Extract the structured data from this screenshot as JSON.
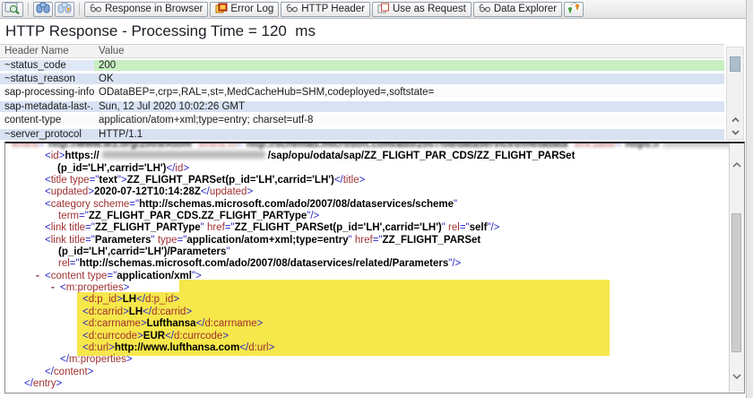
{
  "toolbar": {
    "buttons": [
      {
        "label": "Response in Browser",
        "icon": "glasses-icon"
      },
      {
        "label": "Error Log",
        "icon": "error-log-icon"
      },
      {
        "label": "HTTP Header",
        "icon": "glasses-icon"
      },
      {
        "label": "Use as Request",
        "icon": "copy-icon"
      },
      {
        "label": "Data Explorer",
        "icon": "glasses-icon"
      }
    ],
    "icon_buttons": [
      "display-response-icon",
      "find-icon",
      "find-next-icon",
      "switch-icon"
    ]
  },
  "title": "HTTP Response - Processing Time = 120  ms",
  "header_table": {
    "columns": [
      "Header Name",
      "Value"
    ],
    "rows": [
      {
        "name": "~status_code",
        "value": "200"
      },
      {
        "name": "~status_reason",
        "value": "OK"
      },
      {
        "name": "sap-processing-info",
        "value": "ODataBEP=,crp=,RAL=,st=,MedCacheHub=SHM,codeployed=,softstate="
      },
      {
        "name": "sap-metadata-last-...",
        "value": "Sun, 12 Jul 2020 10:02:26 GMT"
      },
      {
        "name": "content-type",
        "value": "application/atom+xml;type=entry; charset=utf-8"
      },
      {
        "name": "~server_protocol",
        "value": "HTTP/1.1"
      }
    ]
  },
  "colors": {
    "status_ok_value_bg": "#c8eec2",
    "header_row_alt_bg": "#d8e2f2",
    "xml_highlight": "#f6e74b",
    "xml_tag_name": "#a03030",
    "xml_punctuation": "#2929c8"
  },
  "xml_body": {
    "lines": [
      {
        "ind": 0,
        "cls": "blurred",
        "seg": [
          [
            "n",
            "xmlns"
          ],
          [
            "p",
            "=\""
          ],
          [
            "v",
            "http://www.w3.org/2005/Atom"
          ],
          [
            "p",
            "\" "
          ],
          [
            "n",
            "xmlns:m"
          ],
          [
            "p",
            "=\""
          ],
          [
            "v",
            "http://schemas.microsoft.com/ado/2007/08/dataservices/metadata"
          ],
          [
            "p",
            "\" "
          ],
          [
            "n",
            "xml:base"
          ],
          [
            "p",
            "=\""
          ],
          [
            "v",
            "https://"
          ],
          [
            "censor",
            ""
          ],
          [
            "v",
            "/sap/opu/odata/sap/"
          ],
          [
            "p",
            "\">"
          ]
        ]
      },
      {
        "ind": 37,
        "seg": [
          [
            "p",
            "<"
          ],
          [
            "n",
            "id"
          ],
          [
            "p",
            ">"
          ],
          [
            "v",
            "https://"
          ],
          [
            "censor",
            ""
          ],
          [
            "v",
            "/sap/opu/odata/sap/ZZ_FLIGHT_PAR_CDS/ZZ_FLIGHT_PARSet"
          ]
        ]
      },
      {
        "ind": 51,
        "seg": [
          [
            "v",
            "(p_id='LH',carrid='LH')"
          ],
          [
            "p",
            "</"
          ],
          [
            "n",
            "id"
          ],
          [
            "p",
            ">"
          ]
        ]
      },
      {
        "ind": 37,
        "seg": [
          [
            "p",
            "<"
          ],
          [
            "n",
            "title"
          ],
          [
            "n",
            " type"
          ],
          [
            "p",
            "=\""
          ],
          [
            "v",
            "text"
          ],
          [
            "p",
            "\">"
          ],
          [
            "v",
            "ZZ_FLIGHT_PARSet(p_id='LH',carrid='LH')"
          ],
          [
            "p",
            "</"
          ],
          [
            "n",
            "title"
          ],
          [
            "p",
            ">"
          ]
        ]
      },
      {
        "ind": 37,
        "seg": [
          [
            "p",
            "<"
          ],
          [
            "n",
            "updated"
          ],
          [
            "p",
            ">"
          ],
          [
            "v",
            "2020-07-12T10:14:28Z"
          ],
          [
            "p",
            "</"
          ],
          [
            "n",
            "updated"
          ],
          [
            "p",
            ">"
          ]
        ]
      },
      {
        "ind": 37,
        "seg": [
          [
            "p",
            "<"
          ],
          [
            "n",
            "category"
          ],
          [
            "n",
            " scheme"
          ],
          [
            "p",
            "=\""
          ],
          [
            "v",
            "http://schemas.microsoft.com/ado/2007/08/dataservices/scheme"
          ],
          [
            "p",
            "\""
          ]
        ]
      },
      {
        "ind": 52,
        "seg": [
          [
            "n",
            "term"
          ],
          [
            "p",
            "=\""
          ],
          [
            "v",
            "ZZ_FLIGHT_PAR_CDS.ZZ_FLIGHT_PARType"
          ],
          [
            "p",
            "\"/>"
          ]
        ]
      },
      {
        "ind": 37,
        "seg": [
          [
            "p",
            "<"
          ],
          [
            "n",
            "link"
          ],
          [
            "n",
            " title"
          ],
          [
            "p",
            "=\""
          ],
          [
            "v",
            "ZZ_FLIGHT_PARType"
          ],
          [
            "p",
            "\" "
          ],
          [
            "n",
            "href"
          ],
          [
            "p",
            "=\""
          ],
          [
            "v",
            "ZZ_FLIGHT_PARSet(p_id='LH',carrid='LH')"
          ],
          [
            "p",
            "\" "
          ],
          [
            "n",
            "rel"
          ],
          [
            "p",
            "=\""
          ],
          [
            "v",
            "self"
          ],
          [
            "p",
            "\"/>"
          ]
        ]
      },
      {
        "ind": 37,
        "seg": [
          [
            "p",
            "<"
          ],
          [
            "n",
            "link"
          ],
          [
            "n",
            " title"
          ],
          [
            "p",
            "=\""
          ],
          [
            "v",
            "Parameters"
          ],
          [
            "p",
            "\" "
          ],
          [
            "n",
            "type"
          ],
          [
            "p",
            "=\""
          ],
          [
            "v",
            "application/atom+xml;type=entry"
          ],
          [
            "p",
            "\" "
          ],
          [
            "n",
            "href"
          ],
          [
            "p",
            "=\""
          ],
          [
            "v",
            "ZZ_FLIGHT_PARSet"
          ]
        ]
      },
      {
        "ind": 52,
        "seg": [
          [
            "v",
            "(p_id='LH',carrid='LH')/Parameters"
          ],
          [
            "p",
            "\""
          ]
        ]
      },
      {
        "ind": 52,
        "seg": [
          [
            "n",
            "rel"
          ],
          [
            "p",
            "=\""
          ],
          [
            "v",
            "http://schemas.microsoft.com/ado/2007/08/dataservices/related/Parameters"
          ],
          [
            "p",
            "\"/>"
          ]
        ]
      },
      {
        "ind": 37,
        "dash": true,
        "seg": [
          [
            "p",
            "<"
          ],
          [
            "n",
            "content"
          ],
          [
            "n",
            " type"
          ],
          [
            "p",
            "=\""
          ],
          [
            "v",
            "application/xml"
          ],
          [
            "p",
            "\">"
          ]
        ]
      },
      {
        "ind": 54,
        "dash": true,
        "seg": [
          [
            "p",
            "<"
          ],
          [
            "n",
            "m:properties"
          ],
          [
            "p",
            ">"
          ]
        ]
      },
      {
        "ind": 79,
        "seg": [
          [
            "p",
            "<"
          ],
          [
            "n",
            "d:p_id"
          ],
          [
            "p",
            ">"
          ],
          [
            "v",
            "LH"
          ],
          [
            "p",
            "</"
          ],
          [
            "n",
            "d:p_id"
          ],
          [
            "p",
            ">"
          ]
        ]
      },
      {
        "ind": 79,
        "seg": [
          [
            "p",
            "<"
          ],
          [
            "n",
            "d:carrid"
          ],
          [
            "p",
            ">"
          ],
          [
            "v",
            "LH"
          ],
          [
            "p",
            "</"
          ],
          [
            "n",
            "d:carrid"
          ],
          [
            "p",
            ">"
          ]
        ]
      },
      {
        "ind": 79,
        "seg": [
          [
            "p",
            "<"
          ],
          [
            "n",
            "d:carrname"
          ],
          [
            "p",
            ">"
          ],
          [
            "v",
            "Lufthansa"
          ],
          [
            "p",
            "</"
          ],
          [
            "n",
            "d:carrname"
          ],
          [
            "p",
            ">"
          ]
        ]
      },
      {
        "ind": 79,
        "seg": [
          [
            "p",
            "<"
          ],
          [
            "n",
            "d:currcode"
          ],
          [
            "p",
            ">"
          ],
          [
            "v",
            "EUR"
          ],
          [
            "p",
            "</"
          ],
          [
            "n",
            "d:currcode"
          ],
          [
            "p",
            ">"
          ]
        ]
      },
      {
        "ind": 79,
        "seg": [
          [
            "p",
            "<"
          ],
          [
            "n",
            "d:url"
          ],
          [
            "p",
            ">"
          ],
          [
            "v",
            "http://www.lufthansa.com"
          ],
          [
            "p",
            "</"
          ],
          [
            "n",
            "d:url"
          ],
          [
            "p",
            ">"
          ]
        ]
      },
      {
        "ind": 54,
        "seg": [
          [
            "p",
            "</"
          ],
          [
            "n",
            "m:properties"
          ],
          [
            "p",
            ">"
          ]
        ]
      },
      {
        "ind": 37,
        "seg": [
          [
            "p",
            "</"
          ],
          [
            "n",
            "content"
          ],
          [
            "p",
            ">"
          ]
        ]
      },
      {
        "ind": 14,
        "seg": [
          [
            "p",
            "</"
          ],
          [
            "n",
            "entry"
          ],
          [
            "p",
            ">"
          ]
        ]
      }
    ]
  }
}
